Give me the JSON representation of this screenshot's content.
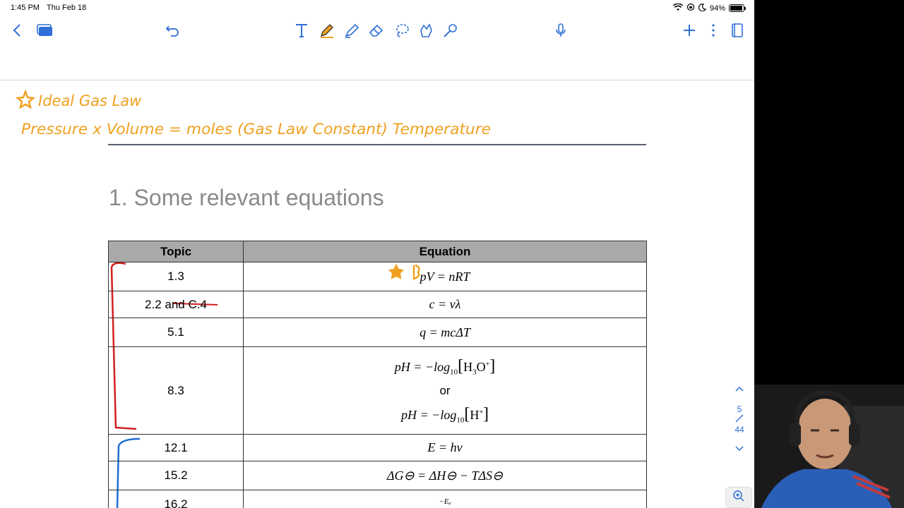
{
  "status_bar": {
    "time": "1:45 PM",
    "date": "Thu Feb 18",
    "battery": "94%",
    "battery_level": 0.94
  },
  "toolbar": {
    "icons": [
      "back-icon",
      "thumbnails-icon",
      "undo-icon",
      "text-tool-icon",
      "pen-icon",
      "highlighter-icon",
      "eraser-icon",
      "lasso-icon",
      "shapes-icon",
      "laser-pointer-icon",
      "microphone-icon",
      "add-icon",
      "more-icon",
      "page-view-icon"
    ],
    "accent": "#2f6fd6"
  },
  "annotations": {
    "line1": "Ideal Gas Law",
    "line2": "Pressure x Volume = moles (Gas Law Constant) Temperature",
    "ink_color": "#f0a020"
  },
  "section_title": "1. Some relevant equations",
  "table": {
    "headers": [
      "Topic",
      "Equation"
    ],
    "rows": [
      {
        "topic": "1.3",
        "equation": "pV = nRT"
      },
      {
        "topic": "2.2 and C.4",
        "equation": "c = vλ"
      },
      {
        "topic": "5.1",
        "equation": "q = mcΔT"
      },
      {
        "topic": "8.3",
        "equation_a": "pH = −log",
        "sub": "10",
        "bracket_a": "H",
        "bracket_a_sub": "3",
        "bracket_a_tail": "O",
        "sup": "+",
        "or": "or",
        "equation_b": "pH = −log",
        "bracket_b": "H"
      },
      {
        "topic": "12.1",
        "equation": "E = hν"
      },
      {
        "topic": "15.2",
        "equation": "ΔG⊖ = ΔH⊖ − TΔS⊖"
      },
      {
        "topic": "16.2",
        "equation": "−Eₐ"
      }
    ]
  },
  "page_indicator": {
    "current": "5",
    "total": "44"
  }
}
